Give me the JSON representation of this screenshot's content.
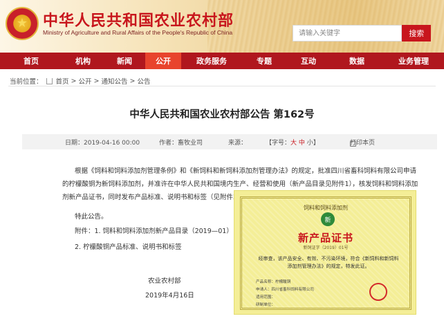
{
  "header": {
    "title_cn": "中华人民共和国农业农村部",
    "title_en": "Ministry of Agriculture and Rural Affairs of the People's Republic of China",
    "search_placeholder": "请输入关键字",
    "search_button": "搜索"
  },
  "nav": {
    "items": [
      {
        "label": "首页",
        "active": false
      },
      {
        "label": "机构",
        "active": false
      },
      {
        "label": "新闻",
        "active": false
      },
      {
        "label": "公开",
        "active": true
      },
      {
        "label": "政务服务",
        "active": false
      },
      {
        "label": "专题",
        "active": false
      },
      {
        "label": "互动",
        "active": false
      },
      {
        "label": "数据",
        "active": false
      },
      {
        "label": "业务管理",
        "active": false
      }
    ]
  },
  "breadcrumb": {
    "prefix": "当前位置：",
    "items": [
      "首页",
      "公开",
      "通知公告",
      "公告"
    ],
    "sep": ">"
  },
  "article": {
    "title": "中华人民共和国农业农村部公告 第162号",
    "meta": {
      "date": "日期：2019-04-16 00:00",
      "author": "作者：畜牧业司",
      "source": "来源：",
      "font_label_prefix": "【字号：",
      "font_big": "大",
      "font_mid": "中",
      "font_small": "小",
      "font_label_suffix": "】",
      "print": "打印本页"
    },
    "para1": "根据《饲料和饲料添加剂管理条例》和《新饲料和新饲料添加剂管理办法》的规定，批准四川省畜科饲料有限公司申请的柠檬酸铜为新饲料添加剂，并准许在中华人民共和国境内生产、经营和使用（新产品目录见附件1），核发饲料和饲料添加剂新产品证书，同时发布产品标准、说明书和标签（见附件2）。产品标准、说明书和标签自发布之日起执行。",
    "para2": "特此公告。",
    "attach1": "附件：1. 饲料和饲料添加剂新产品目录（2019—01）",
    "attach2": "2. 柠檬酸铜产品标准、说明书和标签",
    "signer": "农业农村部",
    "sign_date": "2019年4月16日"
  },
  "certificate": {
    "top": "饲料和饲料添加剂",
    "logo": "新",
    "main": "新产品证书",
    "number": "新饲证字（2019）01号",
    "body": "经审查，该产品安全、有效、不污染环境，符合《新饲料和新饲料添加剂管理办法》的规定，特发此证。",
    "rows": [
      "产品名称：柠檬酸铜",
      "申请人：四川省畜科饲料有限公司",
      "适用范围：",
      "研制单位："
    ]
  },
  "colors": {
    "brand_red": "#c8161d",
    "nav_bg": "#b0171e",
    "nav_active": "#e8442d"
  }
}
